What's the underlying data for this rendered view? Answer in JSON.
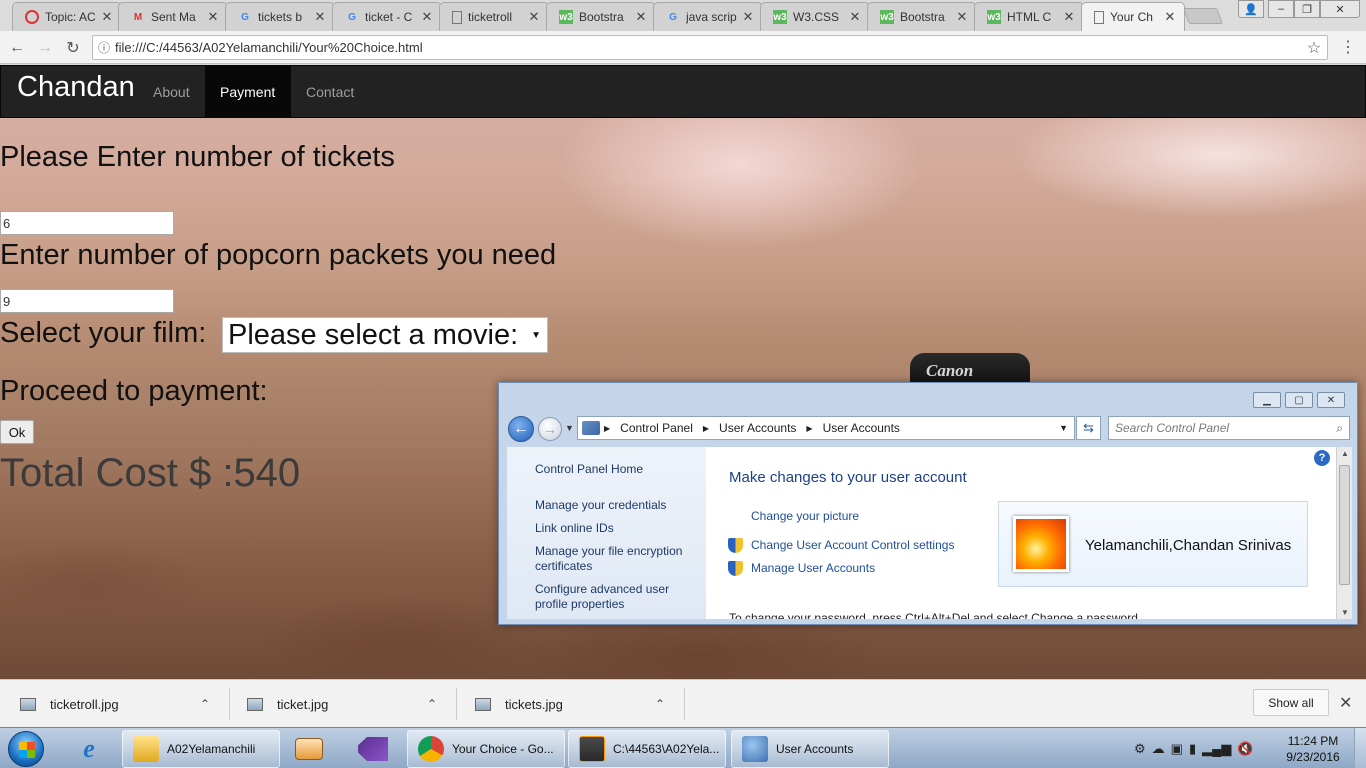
{
  "browser": {
    "tabs": [
      {
        "title": "Topic: AC",
        "icon": "chrome-icon"
      },
      {
        "title": "Sent Ma",
        "icon": "gmail-icon"
      },
      {
        "title": "tickets b",
        "icon": "google-icon"
      },
      {
        "title": "ticket - C",
        "icon": "google-icon"
      },
      {
        "title": "ticketroll",
        "icon": "file-icon"
      },
      {
        "title": "Bootstra",
        "icon": "w3schools-icon"
      },
      {
        "title": "java scrip",
        "icon": "google-icon"
      },
      {
        "title": "W3.CSS",
        "icon": "w3schools-icon"
      },
      {
        "title": "Bootstra",
        "icon": "w3schools-icon"
      },
      {
        "title": "HTML C",
        "icon": "w3schools-icon"
      },
      {
        "title": "Your Ch",
        "icon": "file-icon"
      }
    ],
    "url": "file:///C:/44563/A02Yelamanchili/Your%20Choice.html"
  },
  "page": {
    "navbar": {
      "brand": "Chandan",
      "links": [
        "About",
        "Payment",
        "Contact"
      ],
      "active": "Payment"
    },
    "tickets_heading": "Please Enter number of tickets",
    "tickets_value": "6",
    "popcorn_heading": "Enter number of popcorn packets you need",
    "popcorn_value": "9",
    "film_label": "Select your film:",
    "film_select": "Please select a movie:",
    "payment_heading": "Proceed to payment:",
    "ok_label": "Ok",
    "total": "Total Cost $ :540",
    "background_text": "Canon"
  },
  "control_panel": {
    "breadcrumb": [
      "Control Panel",
      "User Accounts",
      "User Accounts"
    ],
    "search_placeholder": "Search Control Panel",
    "left_links": [
      "Control Panel Home",
      "Manage your credentials",
      "Link online IDs",
      "Manage your file encryption certificates",
      "Configure advanced user profile properties"
    ],
    "heading": "Make changes to your user account",
    "links": [
      "Change your picture",
      "Change User Account Control settings",
      "Manage User Accounts"
    ],
    "user_name": "Yelamanchili,Chandan Srinivas",
    "truncated_text": "To change your password, press Ctrl+Alt+Del and select Change a password."
  },
  "downloads": {
    "files": [
      "ticketroll.jpg",
      "ticket.jpg",
      "tickets.jpg"
    ],
    "show_all": "Show all"
  },
  "taskbar": {
    "items": [
      {
        "label": "A02Yelamanchili",
        "icon": "folder-icon"
      },
      {
        "label": "Your Choice - Go...",
        "icon": "chrome-icon"
      },
      {
        "label": "C:\\44563\\A02Yela...",
        "icon": "sublime-icon"
      },
      {
        "label": "User Accounts",
        "icon": "user-accounts-icon"
      }
    ],
    "time": "11:24 PM",
    "date": "9/23/2016"
  },
  "colors": {
    "navbar_bg": "#222222",
    "link_blue": "#1f4e9a",
    "taskbar": "#8ea8c6"
  }
}
